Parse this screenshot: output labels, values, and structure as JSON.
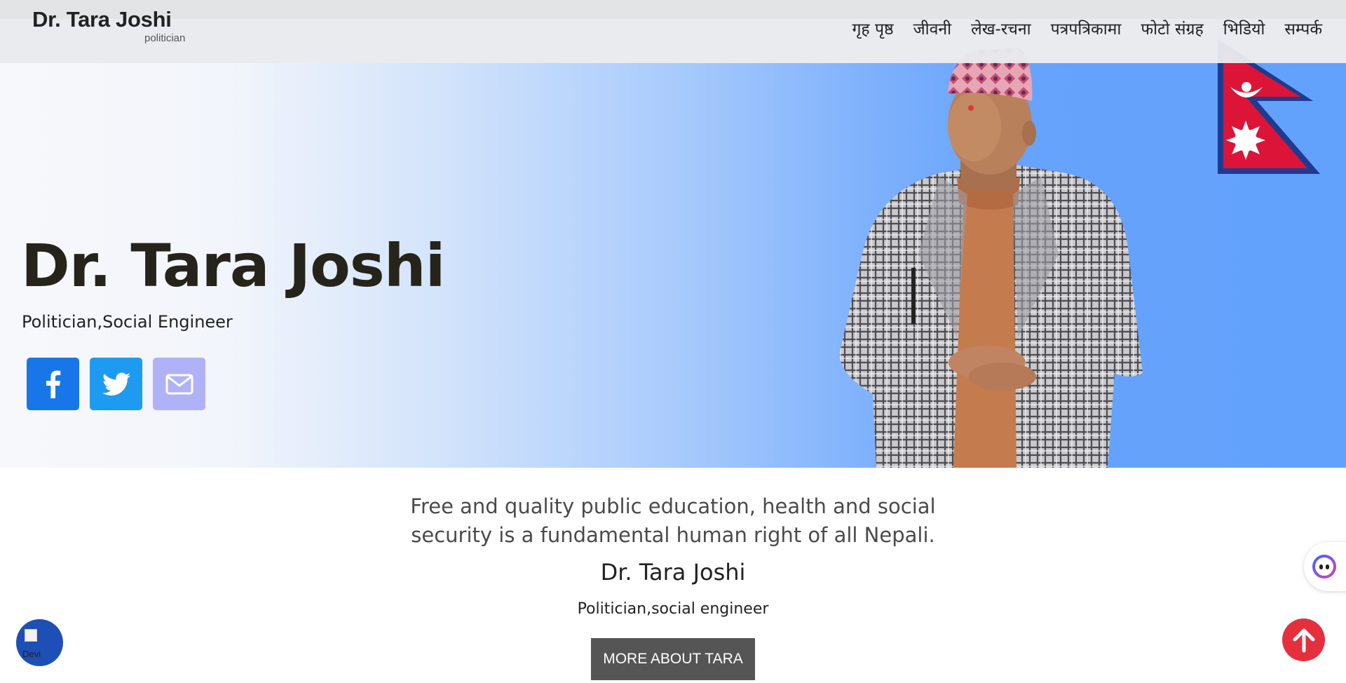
{
  "header": {
    "logo_name": "Dr. Tara Joshi",
    "logo_sub": "politician",
    "nav": [
      {
        "label": "गृह पृष्ठ"
      },
      {
        "label": "जीवनी"
      },
      {
        "label": "लेख-रचना"
      },
      {
        "label": "पत्रपत्रिकामा"
      },
      {
        "label": "फोटो संग्रह"
      },
      {
        "label": "भिडियो"
      },
      {
        "label": "सम्पर्क"
      }
    ]
  },
  "hero": {
    "name": "Dr. Tara Joshi",
    "role": "Politician,Social Engineer",
    "socials": [
      {
        "name": "facebook-icon",
        "color": "#1877e8"
      },
      {
        "name": "twitter-icon",
        "color": "#1d9bf0"
      },
      {
        "name": "mail-icon",
        "color": "#b0b2f8"
      }
    ],
    "gradient_colors": [
      "#f7f8fb",
      "#62a1fc"
    ]
  },
  "quote": {
    "line1": "Free and quality public education, health and social",
    "line2": "security is a fundamental human right of all Nepali.",
    "author": "Dr. Tara Joshi",
    "author_role": "Politician,social engineer",
    "button_label": "MORE ABOUT TARA"
  },
  "widgets": {
    "left_alt_text": "Devi",
    "scroll_top_color": "#e62f3d"
  }
}
